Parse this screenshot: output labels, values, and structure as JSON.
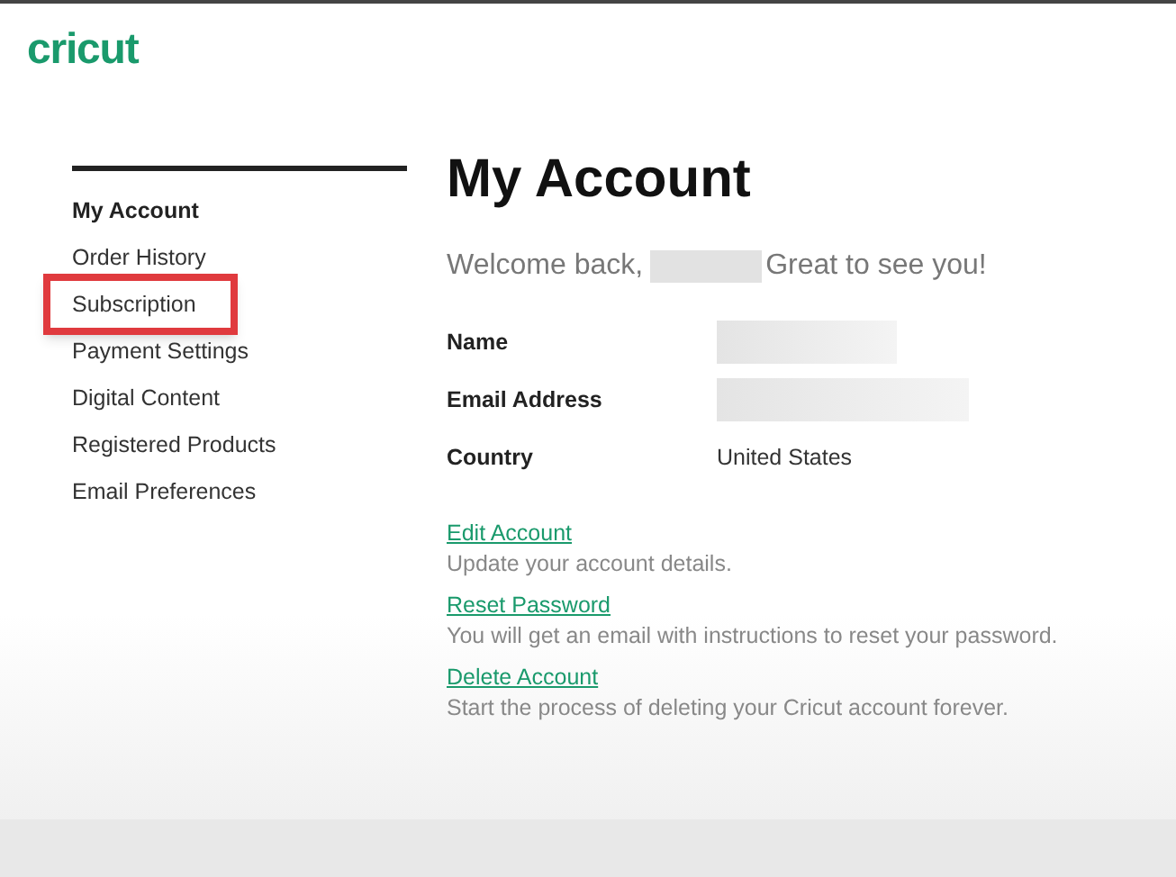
{
  "logo": {
    "text": "cricut"
  },
  "sidebar": {
    "items": [
      {
        "label": "My Account",
        "selected": true,
        "highlighted": false
      },
      {
        "label": "Order History",
        "selected": false,
        "highlighted": false
      },
      {
        "label": "Subscription",
        "selected": false,
        "highlighted": true
      },
      {
        "label": "Payment Settings",
        "selected": false,
        "highlighted": false
      },
      {
        "label": "Digital Content",
        "selected": false,
        "highlighted": false
      },
      {
        "label": "Registered Products",
        "selected": false,
        "highlighted": false
      },
      {
        "label": "Email Preferences",
        "selected": false,
        "highlighted": false
      }
    ]
  },
  "main": {
    "title": "My Account",
    "welcome": {
      "before": "Welcome back,",
      "name_redacted": true,
      "after": "Great to see you!"
    },
    "fields": [
      {
        "label": "Name",
        "redacted": true
      },
      {
        "label": "Email Address",
        "redacted": true
      },
      {
        "label": "Country",
        "value": "United States",
        "redacted": false
      }
    ],
    "actions": [
      {
        "link": "Edit Account",
        "description": "Update your account details."
      },
      {
        "link": "Reset Password",
        "description": "You will get an email with instructions to reset your password."
      },
      {
        "link": "Delete Account",
        "description": "Start the process of deleting your Cricut account forever."
      }
    ]
  }
}
